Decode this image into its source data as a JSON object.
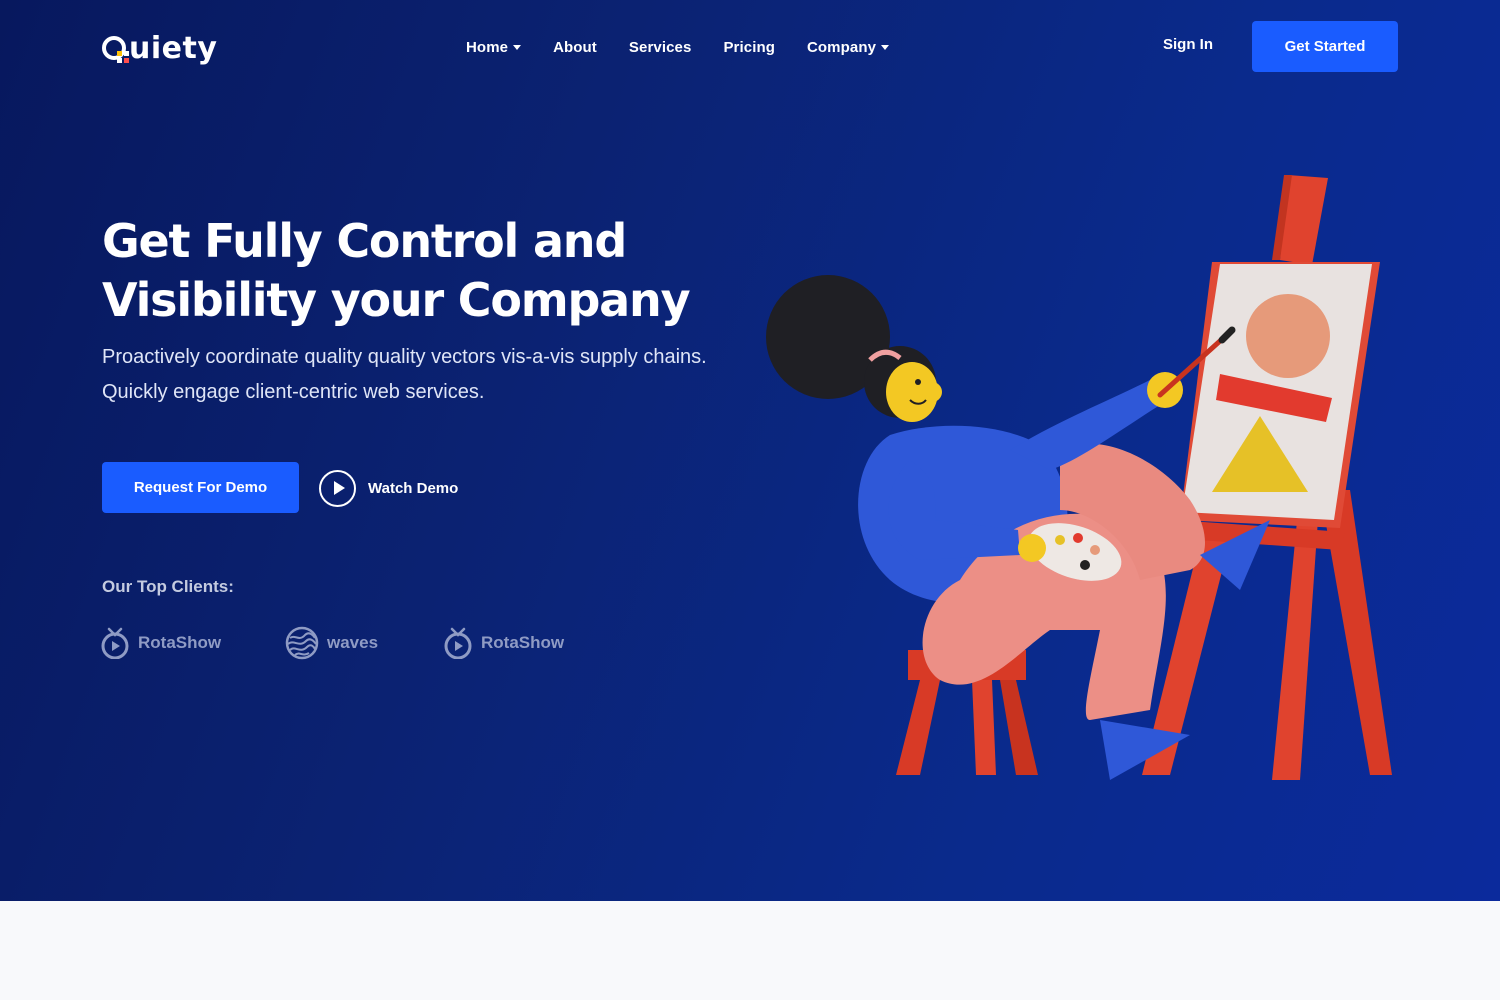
{
  "brand": {
    "name": "uiety",
    "logo_letter": "Q",
    "colors": {
      "primary": "#1a5cff",
      "hero_bg": "#0b2272",
      "white": "#ffffff"
    }
  },
  "nav": {
    "items": [
      {
        "label": "Home",
        "has_dropdown": true
      },
      {
        "label": "About",
        "has_dropdown": false
      },
      {
        "label": "Services",
        "has_dropdown": false
      },
      {
        "label": "Pricing",
        "has_dropdown": false
      },
      {
        "label": "Company",
        "has_dropdown": true
      }
    ],
    "sign_in": "Sign In",
    "cta": "Get Started"
  },
  "hero": {
    "headline_line1": "Get Fully Control and",
    "headline_line2": "Visibility your Company",
    "sub_line1": "Proactively coordinate quality quality vectors vis-a-vis supply chains.",
    "sub_line2": "Quickly engage client-centric web services.",
    "primary_button": "Request For Demo",
    "watch_label": "Watch Demo"
  },
  "clients": {
    "title": "Our Top Clients:",
    "logos": [
      {
        "name": "RotaShow",
        "icon": "tv-icon"
      },
      {
        "name": "waves",
        "icon": "waves-globe-icon"
      },
      {
        "name": "RotaShow",
        "icon": "tv-icon"
      }
    ]
  },
  "illustration": {
    "icon": "artist-painting-easel-illustration"
  }
}
